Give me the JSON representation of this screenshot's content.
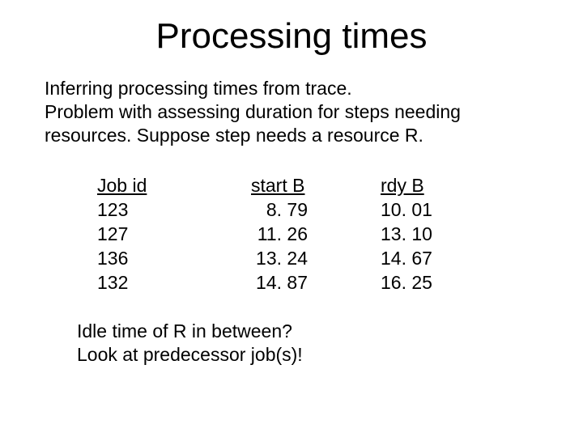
{
  "title": "Processing times",
  "paragraph1": "Inferring processing times from trace.\nProblem with assessing duration for steps needing resources. Suppose step needs a resource R.",
  "table": {
    "headers": {
      "job": "Job id",
      "startB": "start B",
      "rdyB": "rdy B"
    },
    "rows": [
      {
        "job": "123",
        "startB": "  8. 79",
        "rdyB": "10. 01"
      },
      {
        "job": "127",
        "startB": "11. 26",
        "rdyB": "13. 10"
      },
      {
        "job": "136",
        "startB": "13. 24",
        "rdyB": "14. 67"
      },
      {
        "job": "132",
        "startB": "14. 87",
        "rdyB": "16. 25"
      }
    ]
  },
  "paragraph2": "Idle time of R in between?\nLook at predecessor job(s)!",
  "chart_data": {
    "type": "table",
    "title": "Processing times",
    "columns": [
      "Job id",
      "start B",
      "rdy B"
    ],
    "rows": [
      [
        123,
        8.79,
        10.01
      ],
      [
        127,
        11.26,
        13.1
      ],
      [
        136,
        13.24,
        14.67
      ],
      [
        132,
        14.87,
        16.25
      ]
    ]
  }
}
